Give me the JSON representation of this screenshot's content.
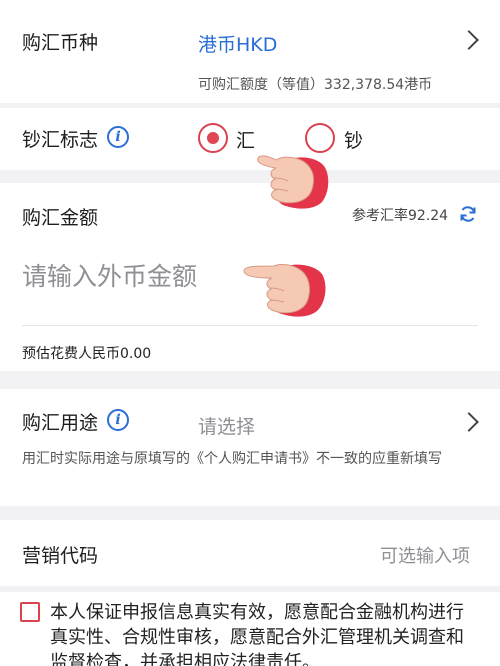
{
  "currency": {
    "label": "购汇币种",
    "value": "港币HKD",
    "quota": "可购汇额度（等值）332,378.54港币"
  },
  "cash_flag": {
    "label": "钞汇标志",
    "options": [
      "汇",
      "钞"
    ],
    "selected": "汇"
  },
  "amount": {
    "label": "购汇金额",
    "rate": "参考汇率92.24",
    "placeholder": "请输入外币金额",
    "estimate": "预估花费人民币0.00"
  },
  "purpose": {
    "label": "购汇用途",
    "placeholder": "请选择",
    "note": "用汇时实际用途与原填写的《个人购汇申请书》不一致的应重新填写"
  },
  "marketing": {
    "label": "营销代码",
    "placeholder": "可选输入项"
  },
  "agreement": {
    "text": "本人保证申报信息真实有效，愿意配合金融机构进行真实性、合规性审核，愿意配合外汇管理机关调查和监督检查，并承担相应法律责任。",
    "checked": false
  },
  "colors": {
    "accent_blue": "#2a6fd6",
    "accent_red": "#e04654"
  }
}
